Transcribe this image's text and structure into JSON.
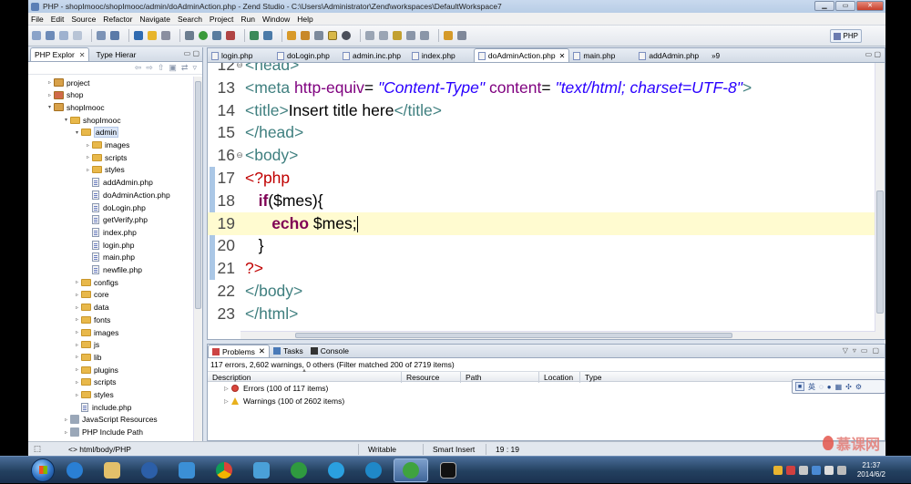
{
  "window": {
    "title": "PHP - shopImooc/shopImooc/admin/doAdminAction.php - Zend Studio - C:\\Users\\Administrator\\Zend\\workspaces\\DefaultWorkspace7"
  },
  "menu": [
    "File",
    "Edit",
    "Source",
    "Refactor",
    "Navigate",
    "Search",
    "Project",
    "Run",
    "Window",
    "Help"
  ],
  "perspective": "PHP",
  "explorer": {
    "tabs": [
      {
        "label": "PHP Explor",
        "active": true
      },
      {
        "label": "Type Hierar",
        "active": false
      }
    ],
    "tree": [
      {
        "label": "project",
        "depth": 1,
        "kind": "project",
        "expanded": false
      },
      {
        "label": "shop",
        "depth": 1,
        "kind": "project-red",
        "expanded": false
      },
      {
        "label": "shopImooc",
        "depth": 1,
        "kind": "project",
        "expanded": true
      },
      {
        "label": "shopImooc",
        "depth": 2,
        "kind": "folder",
        "expanded": true
      },
      {
        "label": "admin",
        "depth": 3,
        "kind": "folder",
        "expanded": true,
        "selected": true
      },
      {
        "label": "images",
        "depth": 4,
        "kind": "folder",
        "expanded": false
      },
      {
        "label": "scripts",
        "depth": 4,
        "kind": "folder",
        "expanded": false
      },
      {
        "label": "styles",
        "depth": 4,
        "kind": "folder",
        "expanded": false
      },
      {
        "label": "addAdmin.php",
        "depth": 4,
        "kind": "file"
      },
      {
        "label": "doAdminAction.php",
        "depth": 4,
        "kind": "file"
      },
      {
        "label": "doLogin.php",
        "depth": 4,
        "kind": "file"
      },
      {
        "label": "getVerify.php",
        "depth": 4,
        "kind": "file"
      },
      {
        "label": "index.php",
        "depth": 4,
        "kind": "file"
      },
      {
        "label": "login.php",
        "depth": 4,
        "kind": "file"
      },
      {
        "label": "main.php",
        "depth": 4,
        "kind": "file"
      },
      {
        "label": "newfile.php",
        "depth": 4,
        "kind": "file"
      },
      {
        "label": "configs",
        "depth": 3,
        "kind": "folder",
        "expanded": false
      },
      {
        "label": "core",
        "depth": 3,
        "kind": "folder",
        "expanded": false
      },
      {
        "label": "data",
        "depth": 3,
        "kind": "folder",
        "expanded": false
      },
      {
        "label": "fonts",
        "depth": 3,
        "kind": "folder",
        "expanded": false
      },
      {
        "label": "images",
        "depth": 3,
        "kind": "folder",
        "expanded": false
      },
      {
        "label": "js",
        "depth": 3,
        "kind": "folder",
        "expanded": false
      },
      {
        "label": "lib",
        "depth": 3,
        "kind": "folder",
        "expanded": false
      },
      {
        "label": "plugins",
        "depth": 3,
        "kind": "folder",
        "expanded": false
      },
      {
        "label": "scripts",
        "depth": 3,
        "kind": "folder",
        "expanded": false
      },
      {
        "label": "styles",
        "depth": 3,
        "kind": "folder",
        "expanded": false
      },
      {
        "label": "include.php",
        "depth": 3,
        "kind": "file"
      },
      {
        "label": "JavaScript Resources",
        "depth": 2,
        "kind": "jsres",
        "expanded": false
      },
      {
        "label": "PHP Include Path",
        "depth": 2,
        "kind": "jsres",
        "expanded": false
      }
    ]
  },
  "editor": {
    "tabs": [
      {
        "label": "login.php",
        "active": false
      },
      {
        "label": "doLogin.php",
        "active": false
      },
      {
        "label": "admin.inc.php",
        "active": false
      },
      {
        "label": "index.php",
        "active": false
      },
      {
        "label": "doAdminAction.php",
        "active": true
      },
      {
        "label": "main.php",
        "active": false
      },
      {
        "label": "addAdmin.php",
        "active": false
      }
    ],
    "overflow": "»9",
    "lines": [
      {
        "n": "12",
        "fold": "⊖",
        "tokens": [
          {
            "t": "<head>",
            "c": "tag"
          }
        ]
      },
      {
        "n": "13",
        "fold": "",
        "tokens": [
          {
            "t": "<meta ",
            "c": "tag"
          },
          {
            "t": "http-equiv",
            "c": "attr"
          },
          {
            "t": "= ",
            "c": "plain"
          },
          {
            "t": "\"Content-Type\"",
            "c": "val"
          },
          {
            "t": " content",
            "c": "attr"
          },
          {
            "t": "= ",
            "c": "plain"
          },
          {
            "t": "\"text/html; charset=UTF-8\"",
            "c": "val"
          },
          {
            "t": ">",
            "c": "tag"
          }
        ]
      },
      {
        "n": "14",
        "fold": "",
        "tokens": [
          {
            "t": "<title>",
            "c": "tag"
          },
          {
            "t": "Insert title here",
            "c": "plain"
          },
          {
            "t": "</title>",
            "c": "tag"
          }
        ]
      },
      {
        "n": "15",
        "fold": "",
        "tokens": [
          {
            "t": "</head>",
            "c": "tag"
          }
        ]
      },
      {
        "n": "16",
        "fold": "⊖",
        "tokens": [
          {
            "t": "<body>",
            "c": "tag"
          }
        ]
      },
      {
        "n": "17",
        "fold": "",
        "tokens": [
          {
            "t": "<?php",
            "c": "php"
          }
        ]
      },
      {
        "n": "18",
        "fold": "",
        "tokens": [
          {
            "t": "   ",
            "c": "plain"
          },
          {
            "t": "if",
            "c": "kw"
          },
          {
            "t": "($mes){",
            "c": "plain"
          }
        ]
      },
      {
        "n": "19",
        "fold": "",
        "current": true,
        "tokens": [
          {
            "t": "      ",
            "c": "plain"
          },
          {
            "t": "echo",
            "c": "kw"
          },
          {
            "t": " $mes;",
            "c": "plain"
          }
        ]
      },
      {
        "n": "20",
        "fold": "",
        "tokens": [
          {
            "t": "   }",
            "c": "plain"
          }
        ]
      },
      {
        "n": "21",
        "fold": "",
        "tokens": [
          {
            "t": "?>",
            "c": "php"
          }
        ]
      },
      {
        "n": "22",
        "fold": "",
        "tokens": [
          {
            "t": "</body>",
            "c": "tag"
          }
        ]
      },
      {
        "n": "23",
        "fold": "",
        "tokens": [
          {
            "t": "</html>",
            "c": "tag"
          }
        ]
      }
    ]
  },
  "problems": {
    "tabs": [
      {
        "label": "Problems",
        "active": true
      },
      {
        "label": "Tasks",
        "active": false
      },
      {
        "label": "Console",
        "active": false
      }
    ],
    "summary": "117 errors, 2,602 warnings, 0 others (Filter matched 200 of 2719 items)",
    "columns": [
      "Description",
      "Resource",
      "Path",
      "Location",
      "Type"
    ],
    "rows": [
      {
        "label": "Errors (100 of 117 items)",
        "severity": "error"
      },
      {
        "label": "Warnings (100 of 2602 items)",
        "severity": "warning"
      }
    ]
  },
  "ime": {
    "mode": "英"
  },
  "status": {
    "breadcrumb": "<> html/body/PHP",
    "mode": "Writable",
    "insert": "Smart Insert",
    "position": "19 : 19"
  },
  "watermark": "慕课网",
  "taskbar": {
    "time": "21:37",
    "date": "2014/6/2"
  },
  "colors": {
    "tag": "#3f7f7f",
    "attr": "#7f007f",
    "value": "#2a00ff",
    "keyword": "#7f0055",
    "php": "#c00000",
    "current_line": "#fffbd0"
  }
}
